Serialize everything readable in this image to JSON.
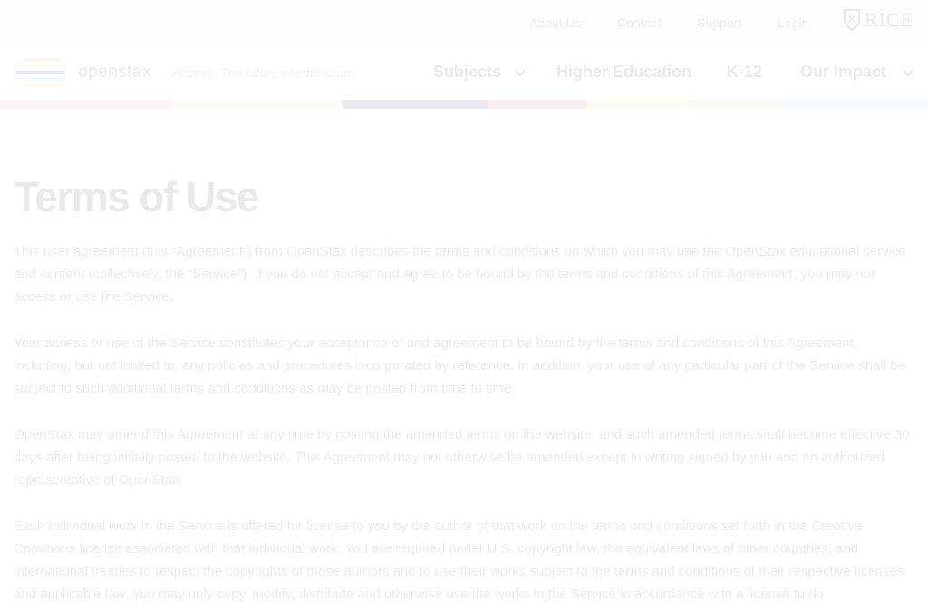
{
  "topbar": {
    "links": [
      {
        "label": "About Us"
      },
      {
        "label": "Contact"
      },
      {
        "label": "Support"
      },
      {
        "label": "Login"
      }
    ],
    "partner_logo": "RICE"
  },
  "header": {
    "brand": "openstax",
    "tagline": "Access. The future of education.",
    "nav": [
      {
        "label": "Subjects",
        "dropdown": true
      },
      {
        "label": "Higher Education",
        "dropdown": false
      },
      {
        "label": "K-12",
        "dropdown": false
      },
      {
        "label": "Our Impact",
        "dropdown": true
      }
    ]
  },
  "accent_colors": [
    "#f4a7a7",
    "#f8c9a0",
    "#2b2f8f",
    "#d95f7c",
    "#fbe58c",
    "#f8c6a2",
    "#8fd3e8"
  ],
  "main": {
    "title": "Terms of Use",
    "paragraphs": [
      "This user agreement (this “Agreement”) from OpenStax describes the terms and conditions on which you may use the OpenStax educational service and content (collectively, the “Service”). If you do not accept and agree to be bound by the terms and conditions of this Agreement, you may not access or use the Service.",
      "Your access or use of the Service constitutes your acceptance of and agreement to be bound by the terms and conditions of this Agreement, including, but not limited to, any policies and procedures incorporated by reference. In addition, your use of any particular part of the Service shall be subject to such additional terms and conditions as may be posted from time to time.",
      "OpenStax may amend this Agreement at any time by posting the amended terms on the website, and such amended terms shall become effective 30 days after being initially posted to the website. This Agreement may not otherwise be amended except in writing signed by you and an authorized representative of OpenStax.",
      "Each individual work in the Service is offered for license to you by the author of that work on the terms and conditions set forth in the Creative Commons license associated with that individual work. You are required under U.S. copyright law, the equivalent laws of other countries, and international treaties to respect the copyrights of those authors and to use their works subject to the terms and conditions of their respective licenses and applicable law. You may only copy, modify, distribute and otherwise use the works in the Service in accordance with a license to do"
    ]
  }
}
